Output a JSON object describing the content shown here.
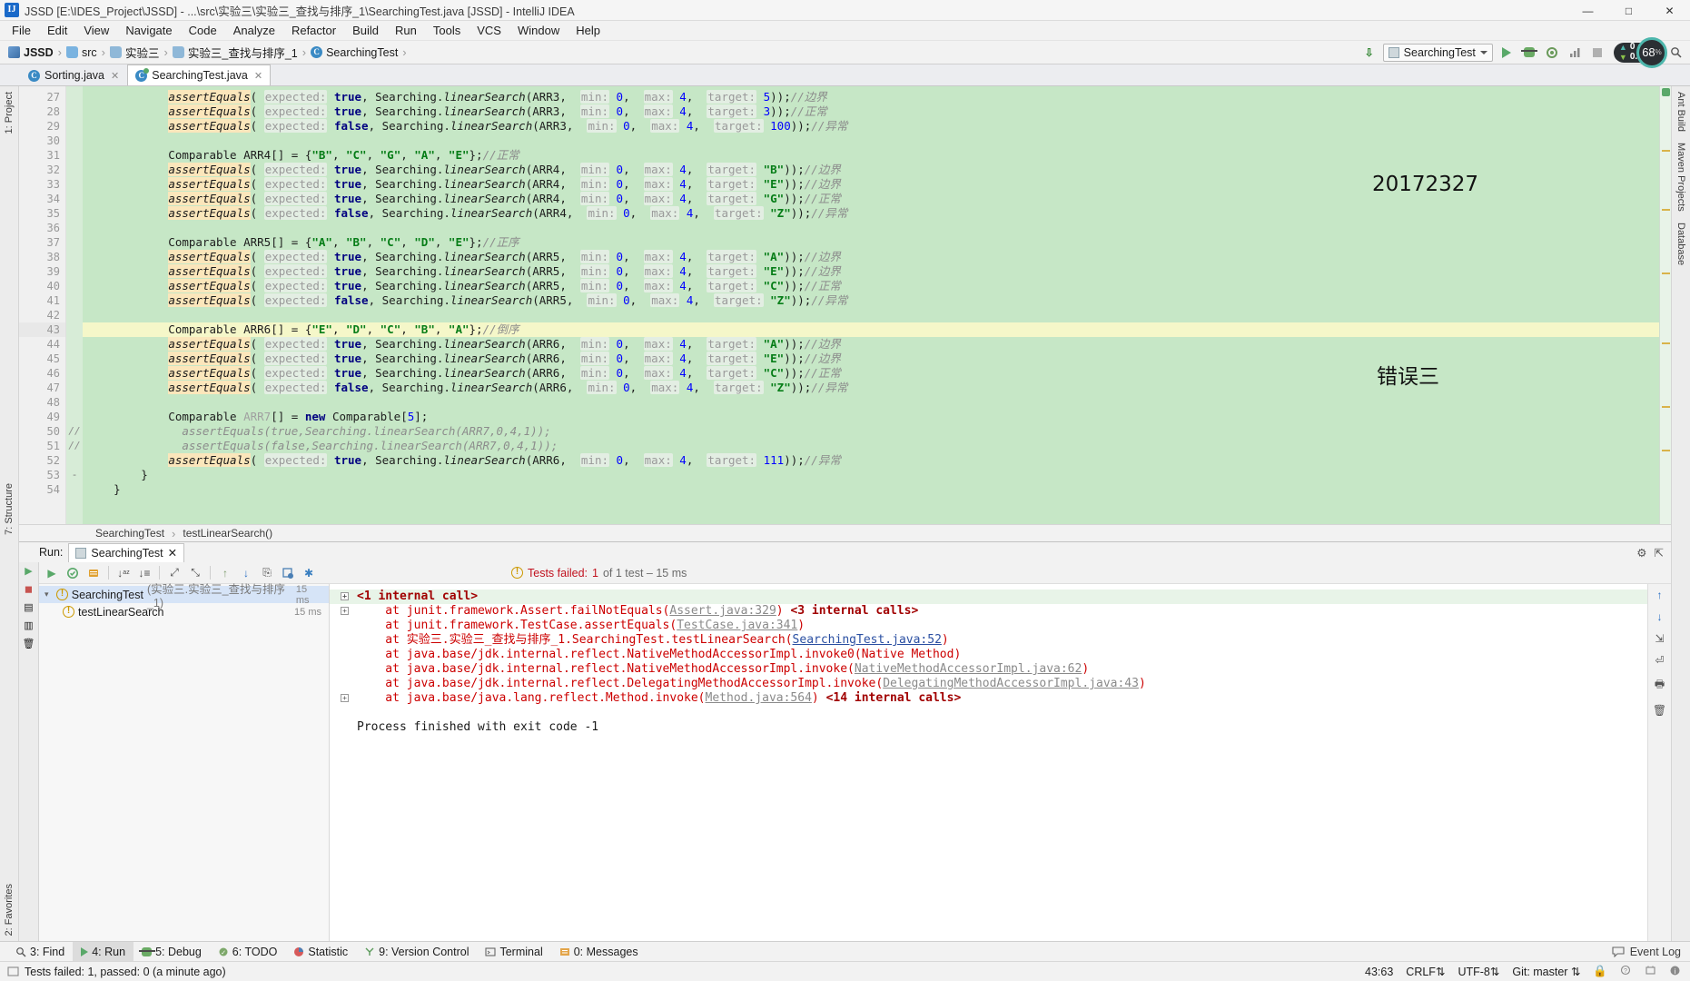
{
  "window": {
    "title": "JSSD [E:\\IDES_Project\\JSSD] - ...\\src\\实验三\\实验三_查找与排序_1\\SearchingTest.java [JSSD] - IntelliJ IDEA",
    "logo": "IJ",
    "minimize": "—",
    "maximize": "□",
    "close": "✕"
  },
  "menu": [
    "File",
    "Edit",
    "View",
    "Navigate",
    "Code",
    "Analyze",
    "Refactor",
    "Build",
    "Run",
    "Tools",
    "VCS",
    "Window",
    "Help"
  ],
  "breadcrumb": [
    {
      "label": "JSSD",
      "icon": "project-icon"
    },
    {
      "label": "src",
      "icon": "folder-icon"
    },
    {
      "label": "实验三",
      "icon": "folder-icon"
    },
    {
      "label": "实验三_查找与排序_1",
      "icon": "folder-icon"
    },
    {
      "label": "SearchingTest",
      "icon": "java-class-icon"
    }
  ],
  "toolbar": {
    "run_config": "SearchingTest",
    "download_icon": "download-icon",
    "run_icon": "run-icon",
    "debug_icon": "debug-icon",
    "coverage_icon": "coverage-icon",
    "profile_icon": "profile-icon",
    "stop_icon": "stop-icon",
    "search_icon": "search-icon"
  },
  "perf": {
    "upload": "0",
    "upload_unit": "K/s",
    "download": "0.1",
    "download_unit": "K/s",
    "cpu": "68",
    "cpu_unit": "%"
  },
  "editor_tabs": [
    {
      "label": "Sorting.java",
      "active": false
    },
    {
      "label": "SearchingTest.java",
      "active": true
    }
  ],
  "annotations": {
    "student_id": "20172327",
    "error_label": "错误三"
  },
  "editor": {
    "first_line": 27,
    "current_line": 43,
    "lines": [
      {
        "n": 27,
        "fold": "",
        "html": "            <span class='mthhl'>assertEquals</span>( <span class='hint'>expected:</span> <span class='kw'>true</span>, Searching.<span class='mth'>linearSearch</span>(ARR3,  <span class='hint'>min:</span> <span class='num'>0</span>,  <span class='hint'>max:</span> <span class='num'>4</span>,  <span class='hint'>target:</span> <span class='num'>5</span>));<span class='cmt'>//边界</span>"
      },
      {
        "n": 28,
        "fold": "",
        "html": "            <span class='mthhl'>assertEquals</span>( <span class='hint'>expected:</span> <span class='kw'>true</span>, Searching.<span class='mth'>linearSearch</span>(ARR3,  <span class='hint'>min:</span> <span class='num'>0</span>,  <span class='hint'>max:</span> <span class='num'>4</span>,  <span class='hint'>target:</span> <span class='num'>3</span>));<span class='cmt'>//正常</span>"
      },
      {
        "n": 29,
        "fold": "",
        "html": "            <span class='mthhl'>assertEquals</span>( <span class='hint'>expected:</span> <span class='kw'>false</span>, Searching.<span class='mth'>linearSearch</span>(ARR3,  <span class='hint'>min:</span> <span class='num'>0</span>,  <span class='hint'>max:</span> <span class='num'>4</span>,  <span class='hint'>target:</span> <span class='num'>100</span>));<span class='cmt'>//异常</span>"
      },
      {
        "n": 30,
        "fold": "",
        "html": ""
      },
      {
        "n": 31,
        "fold": "",
        "html": "            Comparable ARR4[] = {<span class='str'>\"B\"</span>, <span class='str'>\"C\"</span>, <span class='str'>\"G\"</span>, <span class='str'>\"A\"</span>, <span class='str'>\"E\"</span>};<span class='cmt'>//正常</span>"
      },
      {
        "n": 32,
        "fold": "",
        "html": "            <span class='mthhl'>assertEquals</span>( <span class='hint'>expected:</span> <span class='kw'>true</span>, Searching.<span class='mth'>linearSearch</span>(ARR4,  <span class='hint'>min:</span> <span class='num'>0</span>,  <span class='hint'>max:</span> <span class='num'>4</span>,  <span class='hint'>target:</span> <span class='str'>\"B\"</span>));<span class='cmt'>//边界</span>"
      },
      {
        "n": 33,
        "fold": "",
        "html": "            <span class='mthhl'>assertEquals</span>( <span class='hint'>expected:</span> <span class='kw'>true</span>, Searching.<span class='mth'>linearSearch</span>(ARR4,  <span class='hint'>min:</span> <span class='num'>0</span>,  <span class='hint'>max:</span> <span class='num'>4</span>,  <span class='hint'>target:</span> <span class='str'>\"E\"</span>));<span class='cmt'>//边界</span>"
      },
      {
        "n": 34,
        "fold": "",
        "html": "            <span class='mthhl'>assertEquals</span>( <span class='hint'>expected:</span> <span class='kw'>true</span>, Searching.<span class='mth'>linearSearch</span>(ARR4,  <span class='hint'>min:</span> <span class='num'>0</span>,  <span class='hint'>max:</span> <span class='num'>4</span>,  <span class='hint'>target:</span> <span class='str'>\"G\"</span>));<span class='cmt'>//正常</span>"
      },
      {
        "n": 35,
        "fold": "",
        "html": "            <span class='mthhl'>assertEquals</span>( <span class='hint'>expected:</span> <span class='kw'>false</span>, Searching.<span class='mth'>linearSearch</span>(ARR4,  <span class='hint'>min:</span> <span class='num'>0</span>,  <span class='hint'>max:</span> <span class='num'>4</span>,  <span class='hint'>target:</span> <span class='str'>\"Z\"</span>));<span class='cmt'>//异常</span>"
      },
      {
        "n": 36,
        "fold": "",
        "html": ""
      },
      {
        "n": 37,
        "fold": "",
        "html": "            Comparable ARR5[] = {<span class='str'>\"A\"</span>, <span class='str'>\"B\"</span>, <span class='str'>\"C\"</span>, <span class='str'>\"D\"</span>, <span class='str'>\"E\"</span>};<span class='cmt'>//正序</span>"
      },
      {
        "n": 38,
        "fold": "",
        "html": "            <span class='mthhl'>assertEquals</span>( <span class='hint'>expected:</span> <span class='kw'>true</span>, Searching.<span class='mth'>linearSearch</span>(ARR5,  <span class='hint'>min:</span> <span class='num'>0</span>,  <span class='hint'>max:</span> <span class='num'>4</span>,  <span class='hint'>target:</span> <span class='str'>\"A\"</span>));<span class='cmt'>//边界</span>"
      },
      {
        "n": 39,
        "fold": "",
        "html": "            <span class='mthhl'>assertEquals</span>( <span class='hint'>expected:</span> <span class='kw'>true</span>, Searching.<span class='mth'>linearSearch</span>(ARR5,  <span class='hint'>min:</span> <span class='num'>0</span>,  <span class='hint'>max:</span> <span class='num'>4</span>,  <span class='hint'>target:</span> <span class='str'>\"E\"</span>));<span class='cmt'>//边界</span>"
      },
      {
        "n": 40,
        "fold": "",
        "html": "            <span class='mthhl'>assertEquals</span>( <span class='hint'>expected:</span> <span class='kw'>true</span>, Searching.<span class='mth'>linearSearch</span>(ARR5,  <span class='hint'>min:</span> <span class='num'>0</span>,  <span class='hint'>max:</span> <span class='num'>4</span>,  <span class='hint'>target:</span> <span class='str'>\"C\"</span>));<span class='cmt'>//正常</span>"
      },
      {
        "n": 41,
        "fold": "",
        "html": "            <span class='mthhl'>assertEquals</span>( <span class='hint'>expected:</span> <span class='kw'>false</span>, Searching.<span class='mth'>linearSearch</span>(ARR5,  <span class='hint'>min:</span> <span class='num'>0</span>,  <span class='hint'>max:</span> <span class='num'>4</span>,  <span class='hint'>target:</span> <span class='str'>\"Z\"</span>));<span class='cmt'>//异常</span>"
      },
      {
        "n": 42,
        "fold": "",
        "html": ""
      },
      {
        "n": 43,
        "fold": "",
        "hl": true,
        "html": "            Comparable ARR6[] = {<span class='str'>\"E\"</span>, <span class='str'>\"D\"</span>, <span class='str'>\"C\"</span>, <span class='str'>\"B\"</span>, <span class='str'>\"A\"</span>};<span class='cmt'>//倒序</span>"
      },
      {
        "n": 44,
        "fold": "",
        "html": "            <span class='mthhl'>assertEquals</span>( <span class='hint'>expected:</span> <span class='kw'>true</span>, Searching.<span class='mth'>linearSearch</span>(ARR6,  <span class='hint'>min:</span> <span class='num'>0</span>,  <span class='hint'>max:</span> <span class='num'>4</span>,  <span class='hint'>target:</span> <span class='str'>\"A\"</span>));<span class='cmt'>//边界</span>"
      },
      {
        "n": 45,
        "fold": "",
        "html": "            <span class='mthhl'>assertEquals</span>( <span class='hint'>expected:</span> <span class='kw'>true</span>, Searching.<span class='mth'>linearSearch</span>(ARR6,  <span class='hint'>min:</span> <span class='num'>0</span>,  <span class='hint'>max:</span> <span class='num'>4</span>,  <span class='hint'>target:</span> <span class='str'>\"E\"</span>));<span class='cmt'>//边界</span>"
      },
      {
        "n": 46,
        "fold": "",
        "html": "            <span class='mthhl'>assertEquals</span>( <span class='hint'>expected:</span> <span class='kw'>true</span>, Searching.<span class='mth'>linearSearch</span>(ARR6,  <span class='hint'>min:</span> <span class='num'>0</span>,  <span class='hint'>max:</span> <span class='num'>4</span>,  <span class='hint'>target:</span> <span class='str'>\"C\"</span>));<span class='cmt'>//正常</span>"
      },
      {
        "n": 47,
        "fold": "",
        "html": "            <span class='mthhl'>assertEquals</span>( <span class='hint'>expected:</span> <span class='kw'>false</span>, Searching.<span class='mth'>linearSearch</span>(ARR6,  <span class='hint'>min:</span> <span class='num'>0</span>,  <span class='hint'>max:</span> <span class='num'>4</span>,  <span class='hint'>target:</span> <span class='str'>\"Z\"</span>));<span class='cmt'>//异常</span>"
      },
      {
        "n": 48,
        "fold": "",
        "html": ""
      },
      {
        "n": 49,
        "fold": "",
        "html": "            Comparable <span class='gray'>ARR7</span>[] = <span class='kw'>new</span> Comparable[<span class='num'>5</span>];"
      },
      {
        "n": 50,
        "fold": "//",
        "html": "              <span class='cmt'>assertEquals(true,Searching.linearSearch(ARR7,0,4,1));</span>"
      },
      {
        "n": 51,
        "fold": "//",
        "html": "              <span class='cmt'>assertEquals(false,Searching.linearSearch(ARR7,0,4,1));</span>"
      },
      {
        "n": 52,
        "fold": "",
        "html": "            <span class='mthhl'>assertEquals</span>( <span class='hint'>expected:</span> <span class='kw'>true</span>, Searching.<span class='mth'>linearSearch</span>(ARR6,  <span class='hint'>min:</span> <span class='num'>0</span>,  <span class='hint'>max:</span> <span class='num'>4</span>,  <span class='hint'>target:</span> <span class='num'>111</span>));<span class='cmt'>//异常</span>"
      },
      {
        "n": 53,
        "fold": "-",
        "html": "        }"
      },
      {
        "n": 54,
        "fold": "",
        "html": "    }"
      }
    ]
  },
  "editor_breadcrumb": [
    "SearchingTest",
    "testLinearSearch()"
  ],
  "run_panel": {
    "label": "Run:",
    "tab": "SearchingTest",
    "close": "✕",
    "settings_icon": "gear-icon",
    "hide_icon": "hide-icon",
    "status": {
      "headline": "Tests failed:",
      "count": "1",
      "detail": "of 1 test – 15 ms"
    },
    "tree": [
      {
        "label": "SearchingTest",
        "suffix": "(实验三.实验三_查找与排序_1)",
        "time": "15 ms",
        "selected": true,
        "icon": "warning-icon",
        "arrow": "▾"
      },
      {
        "label": "testLinearSearch",
        "suffix": "",
        "time": "15 ms",
        "selected": false,
        "icon": "warning-icon",
        "arrow": ""
      }
    ],
    "toolbar_icons": [
      "rerun-icon",
      "rerun-failed-icon",
      "toggle-auto-test-icon",
      "sort-alpha-icon",
      "sort-duration-icon",
      "expand-all-icon",
      "collapse-all-icon",
      "prev-fail-icon",
      "next-fail-icon",
      "export-icon",
      "history-icon",
      "settings-icon"
    ],
    "console": [
      {
        "plus": true,
        "cls": "internal",
        "html": "&lt;1 internal call&gt;"
      },
      {
        "plus": true,
        "cls": "",
        "html": "    at junit.framework.Assert.failNotEquals(<span class='lnk-gray'>Assert.java:329</span>) <span class='cs-bold'>&lt;3 internal calls&gt;</span>"
      },
      {
        "plus": false,
        "cls": "",
        "html": "    at junit.framework.TestCase.assertEquals(<span class='lnk-gray'>TestCase.java:341</span>)"
      },
      {
        "plus": false,
        "cls": "",
        "html": "    at 实验三.实验三_查找与排序_1.SearchingTest.testLinearSearch(<span class='lnk'>SearchingTest.java:52</span>)"
      },
      {
        "plus": false,
        "cls": "",
        "html": "    at java.base/jdk.internal.reflect.NativeMethodAccessorImpl.invoke0(Native Method)"
      },
      {
        "plus": false,
        "cls": "",
        "html": "    at java.base/jdk.internal.reflect.NativeMethodAccessorImpl.invoke(<span class='lnk-gray'>NativeMethodAccessorImpl.java:62</span>)"
      },
      {
        "plus": false,
        "cls": "",
        "html": "    at java.base/jdk.internal.reflect.DelegatingMethodAccessorImpl.invoke(<span class='lnk-gray'>DelegatingMethodAccessorImpl.java:43</span>)"
      },
      {
        "plus": true,
        "cls": "",
        "html": "    at java.base/java.lang.reflect.Method.invoke(<span class='lnk-gray'>Method.java:564</span>) <span class='cs-bold'>&lt;14 internal calls&gt;</span>"
      },
      {
        "plus": false,
        "cls": "",
        "html": ""
      },
      {
        "plus": false,
        "cls": "",
        "html": "<span class='cs-exit'>Process finished with exit code -1</span>"
      }
    ]
  },
  "left_rail": [
    "1: Project",
    "7: Structure",
    "2: Favorites"
  ],
  "right_rail": [
    "Ant Build",
    "Maven Projects",
    "Database"
  ],
  "bottom_tabs": [
    {
      "label": "3: Find",
      "icon": "search-icon",
      "active": false
    },
    {
      "label": "4: Run",
      "icon": "run-icon",
      "active": true
    },
    {
      "label": "5: Debug",
      "icon": "debug-icon",
      "active": false
    },
    {
      "label": "6: TODO",
      "icon": "todo-icon",
      "active": false
    },
    {
      "label": "Statistic",
      "icon": "statistic-icon",
      "active": false
    },
    {
      "label": "9: Version Control",
      "icon": "vcs-icon",
      "active": false
    },
    {
      "label": "Terminal",
      "icon": "terminal-icon",
      "active": false
    },
    {
      "label": "0: Messages",
      "icon": "messages-icon",
      "active": false
    }
  ],
  "bottom_right": {
    "event_log": "Event Log",
    "event_log_icon": "balloon-icon"
  },
  "status_bar": {
    "message": "Tests failed: 1, passed: 0 (a minute ago)",
    "message_icon": "console-icon",
    "caret": "43:63",
    "line_sep": "CRLF",
    "encoding": "UTF-8",
    "branch": "Git: master",
    "lock_icon": "lock-icon",
    "inspect_icon": "inspection-icon",
    "mem_icon": "memory-icon",
    "info_icon": "info-icon"
  }
}
